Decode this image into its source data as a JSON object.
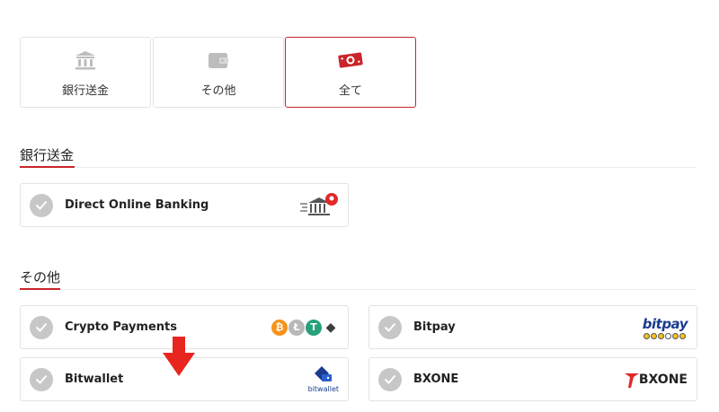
{
  "tabs": [
    {
      "label": "銀行送金",
      "icon": "bank-icon",
      "active": false
    },
    {
      "label": "その他",
      "icon": "wallet-icon",
      "active": false
    },
    {
      "label": "全て",
      "icon": "cash-icon",
      "active": true
    }
  ],
  "sections": [
    {
      "title": "銀行送金",
      "items": [
        {
          "label": "Direct Online Banking",
          "logo": "direct-online-banking-logo"
        }
      ]
    },
    {
      "title": "その他",
      "items": [
        {
          "label": "Crypto Payments",
          "logo": "crypto-coins-logo"
        },
        {
          "label": "Bitpay",
          "logo": "bitpay-logo",
          "logo_text": "bitpay"
        },
        {
          "label": "Bitwallet",
          "logo": "bitwallet-logo",
          "logo_text": "bitwallet"
        },
        {
          "label": "BXONE",
          "logo": "bxone-logo",
          "logo_text": "BXONE"
        }
      ]
    }
  ],
  "coins": [
    {
      "symbol": "₿",
      "color": "#f7931a",
      "name": "bitcoin-icon"
    },
    {
      "symbol": "Ł",
      "color": "#b8b8b8",
      "name": "litecoin-icon"
    },
    {
      "symbol": "T",
      "color": "#26a17b",
      "name": "tether-icon"
    },
    {
      "symbol": "◆",
      "color": "#3c3c3d",
      "name": "ethereum-icon"
    }
  ],
  "colors": {
    "accent": "#c9252b",
    "check": "#c7c7c7",
    "border": "#e3e3e3"
  },
  "annotation": {
    "icon": "red-down-arrow-icon",
    "color": "#e8251f"
  }
}
